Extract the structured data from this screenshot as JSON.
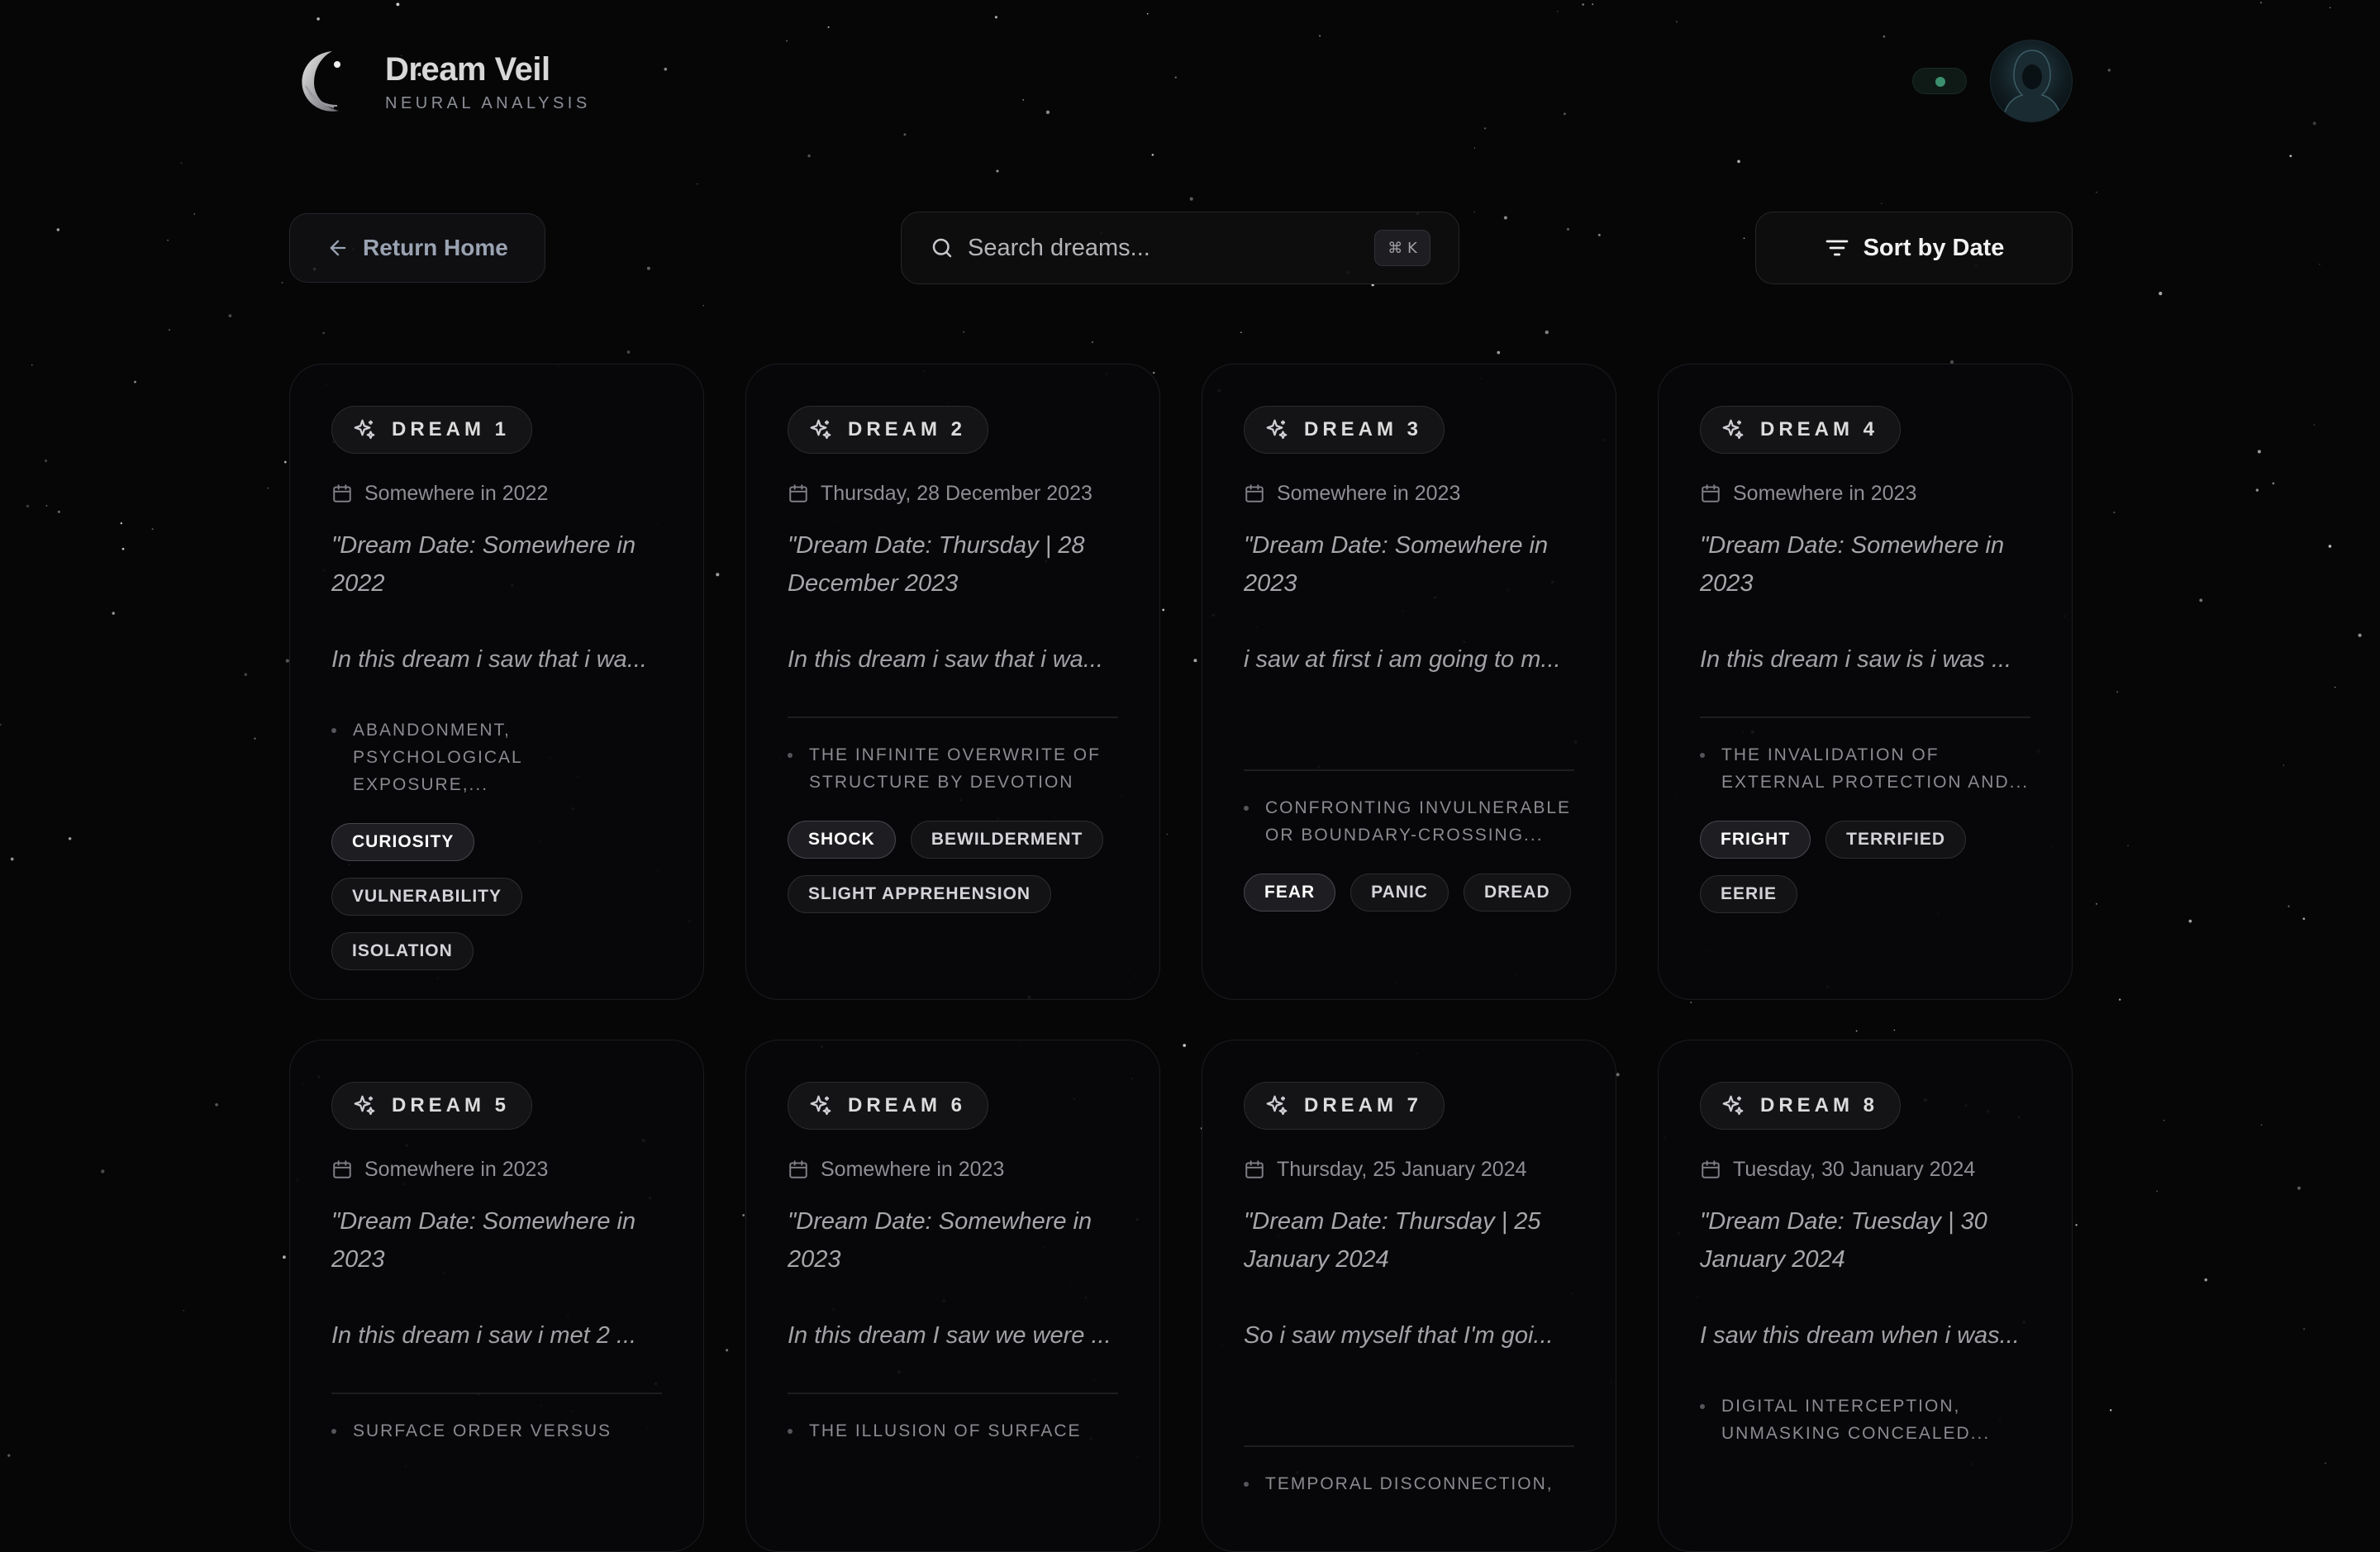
{
  "app": {
    "title": "Dream Veil",
    "subtitle": "NEURAL ANALYSIS"
  },
  "toolbar": {
    "return_label": "Return Home",
    "search_placeholder": "Search dreams...",
    "search_shortcut": "⌘ K",
    "sort_label": "Sort by Date"
  },
  "colors": {
    "background": "#060607",
    "card": "#08080a",
    "accent_status": "#3b8f6e"
  },
  "icons": {
    "logo": "crescent-moon-logo",
    "back": "arrow-left-icon",
    "search": "search-icon",
    "sort": "filter-lines-icon",
    "badge": "sparkles-icon",
    "date": "calendar-icon"
  },
  "dreams": [
    {
      "label": "DREAM 1",
      "date": "Somewhere in 2022",
      "quote": "\"Dream Date: Somewhere in 2022",
      "excerpt": "In this dream i saw that i wa...",
      "theme": "ABANDONMENT, PSYCHOLOGICAL EXPOSURE,...",
      "tags": [
        "CURIOSITY",
        "VULNERABILITY",
        "ISOLATION"
      ]
    },
    {
      "label": "DREAM 2",
      "date": "Thursday, 28 December 2023",
      "quote": "\"Dream Date: Thursday | 28 December 2023",
      "excerpt": "In this dream i saw that i wa...",
      "theme": "THE INFINITE OVERWRITE OF STRUCTURE BY DEVOTION",
      "tags": [
        "SHOCK",
        "BEWILDERMENT",
        "SLIGHT APPREHENSION"
      ]
    },
    {
      "label": "DREAM 3",
      "date": "Somewhere in 2023",
      "quote": "\"Dream Date: Somewhere in 2023",
      "excerpt": "i saw at first i am going to m...",
      "theme": "CONFRONTING INVULNERABLE OR BOUNDARY-CROSSING...",
      "tags": [
        "FEAR",
        "PANIC",
        "DREAD"
      ]
    },
    {
      "label": "DREAM 4",
      "date": "Somewhere in 2023",
      "quote": "\"Dream Date: Somewhere in 2023",
      "excerpt": "In this dream i saw is i was ...",
      "theme": "THE INVALIDATION OF EXTERNAL PROTECTION AND...",
      "tags": [
        "FRIGHT",
        "TERRIFIED",
        "EERIE"
      ]
    },
    {
      "label": "DREAM 5",
      "date": "Somewhere in 2023",
      "quote": "\"Dream Date: Somewhere in 2023",
      "excerpt": "In this dream i saw i met 2 ...",
      "theme": "SURFACE ORDER VERSUS",
      "tags": []
    },
    {
      "label": "DREAM 6",
      "date": "Somewhere in 2023",
      "quote": "\"Dream Date: Somewhere in 2023",
      "excerpt": "In this dream I saw we were ...",
      "theme": "THE ILLUSION OF SURFACE",
      "tags": []
    },
    {
      "label": "DREAM 7",
      "date": "Thursday, 25 January 2024",
      "quote": "\"Dream Date: Thursday | 25 January 2024",
      "excerpt": "So i saw myself that I'm goi...",
      "theme": "TEMPORAL DISCONNECTION,",
      "tags": []
    },
    {
      "label": "DREAM 8",
      "date": "Tuesday, 30 January 2024",
      "quote": "\"Dream Date: Tuesday | 30 January 2024",
      "excerpt": "I saw this dream when i was...",
      "theme": "DIGITAL INTERCEPTION, UNMASKING CONCEALED...",
      "tags": []
    }
  ]
}
